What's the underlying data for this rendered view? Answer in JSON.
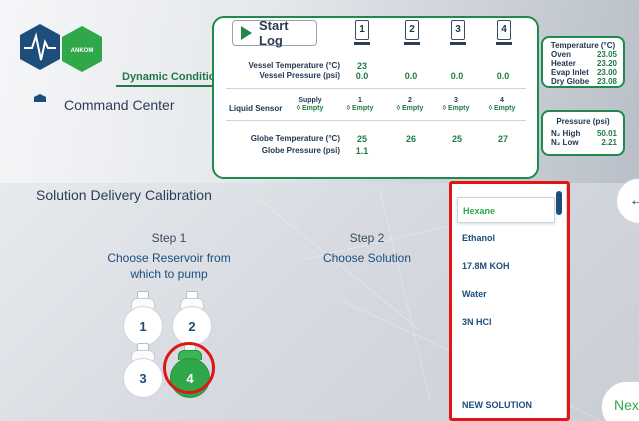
{
  "header": {
    "logo_text": "ANKOM",
    "app_title": "Command Center",
    "dynamic_conditions_label": "Dynamic Conditions",
    "start_log_label": "Start Log"
  },
  "vessels": {
    "numbers": [
      "1",
      "2",
      "3",
      "4"
    ],
    "vessel_temperature_label": "Vessel Temperature (°C)",
    "vessel_temperature": [
      "23",
      "",
      "",
      ""
    ],
    "vessel_pressure_label": "Vessel Pressure (psi)",
    "vessel_pressure": [
      "0.0",
      "0.0",
      "0.0",
      "0.0"
    ],
    "liquid_sensor_label": "Liquid Sensor",
    "sensors": [
      {
        "name": "Supply",
        "state": "Empty"
      },
      {
        "name": "1",
        "state": "Empty"
      },
      {
        "name": "2",
        "state": "Empty"
      },
      {
        "name": "3",
        "state": "Empty"
      },
      {
        "name": "4",
        "state": "Empty"
      }
    ],
    "globe_temperature_label": "Globe Temperature (°C)",
    "globe_temperature": [
      "25",
      "26",
      "25",
      "27"
    ],
    "globe_pressure_label": "Globe Pressure (psi)",
    "globe_pressure": "1.1"
  },
  "temperature_box": {
    "title": "Temperature (°C)",
    "rows": [
      {
        "label": "Oven",
        "value": "23.05"
      },
      {
        "label": "Heater",
        "value": "23.20"
      },
      {
        "label": "Evap Inlet",
        "value": "23.00"
      },
      {
        "label": "Dry Globe",
        "value": "23.08"
      }
    ]
  },
  "pressure_box": {
    "title": "Pressure (psi)",
    "rows": [
      {
        "label": "N₂ High",
        "value": "50.01"
      },
      {
        "label": "N₂ Low",
        "value": "2.21"
      }
    ]
  },
  "main": {
    "title": "Solution Delivery Calibration",
    "step1_title": "Step 1",
    "step1_desc_line1": "Choose Reservoir from",
    "step1_desc_line2": "which to pump",
    "step2_title": "Step 2",
    "step2_desc": "Choose Solution",
    "reservoirs": [
      "1",
      "2",
      "3",
      "4"
    ],
    "selected_reservoir": "4"
  },
  "solutions": {
    "items": [
      "Hexane",
      "Ethanol",
      "17.8M KOH",
      "Water",
      "3N HCl"
    ],
    "selected": "Hexane",
    "new_solution_label": "NEW SOLUTION"
  },
  "nav": {
    "back_symbol": "←",
    "next_label": "Next"
  },
  "colors": {
    "accent_green": "#2fa84a",
    "text_blue": "#1d4d7a",
    "highlight_red": "#e01616"
  }
}
